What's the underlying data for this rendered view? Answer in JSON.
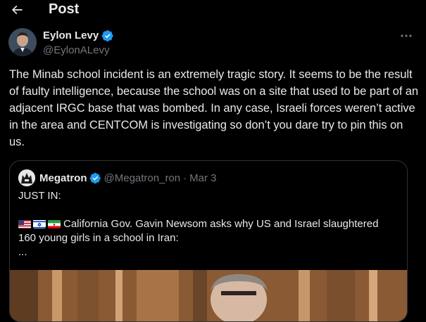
{
  "header": {
    "title": "Post"
  },
  "author": {
    "name": "Eylon Levy",
    "handle": "@EylonALevy",
    "verified": true
  },
  "post": {
    "text": "The Minab school incident is an extremely tragic story. It seems to be the result of faulty intelligence, because the school was on a site that used to be part of an adjacent IRGC base that was bombed. In any case, Israeli forces weren’t active in the area and CENTCOM is investigating so don’t you dare try to pin this on us."
  },
  "quote": {
    "name": "Megatron",
    "handle": "@Megatron_ron",
    "separator": "·",
    "date": "Mar 3",
    "verified": true,
    "line1": "JUST IN:",
    "line2": "California Gov. Gavin Newsom asks why US and Israel slaughtered 160 young girls in a school in Iran:",
    "line3": "...",
    "flags": [
      "us-flag",
      "israel-flag",
      "iran-flag"
    ]
  },
  "colors": {
    "background": "#000000",
    "text": "#e7e9ea",
    "secondary": "#71767b",
    "verified": "#1d9bf0",
    "border": "#2f3336"
  }
}
